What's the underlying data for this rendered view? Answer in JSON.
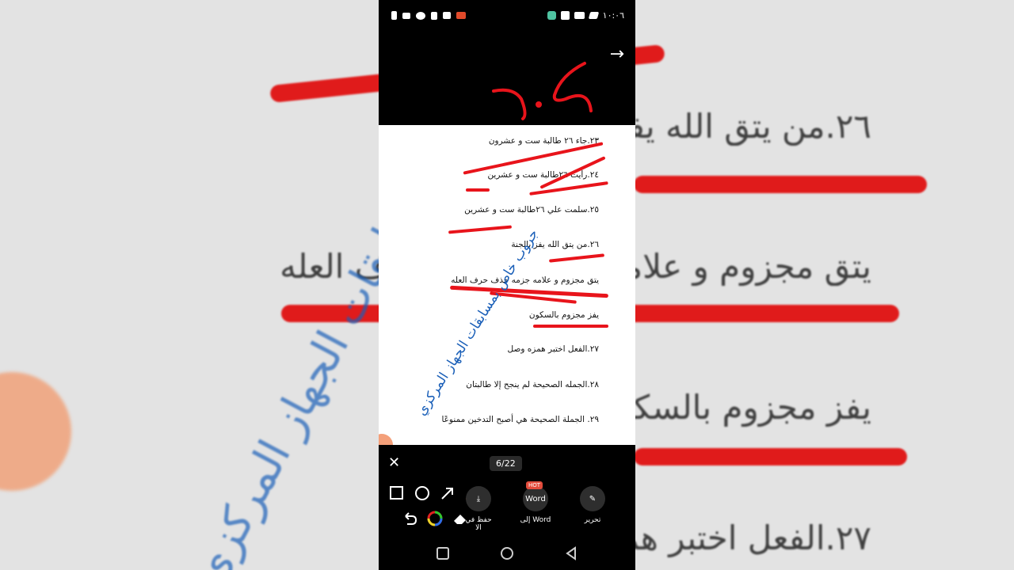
{
  "background": {
    "lines": [
      "٢٦.من يتق الله يفز",
      "يتق مجزوم و علامه جزمه حذف حرف العله",
      "يفز مجزوم بالسكون",
      "٢٧.الفعل اختبر همزه وصل"
    ],
    "watermark": "جروب خاص بمسابقات الجهاز المركزي"
  },
  "status_bar": {
    "time": "١٠:٠٦"
  },
  "document": {
    "lines": [
      "٢٣.جاء ٢٦ طالبة ست و عشرون",
      "٢٤.رأيت ٢٦طالبة ست و عشرين",
      "٢٥.سلمت علي ٢٦طالبة ست و عشرين",
      "٢٦.من يتق الله يفز بالجنة",
      "يتق مجزوم و علامه جزمه حذف حرف العله",
      "يفز مجزوم بالسكون",
      "٢٧.الفعل اختبر همزه وصل",
      "٢٨.الجمله الصحيحة لم ينجح إلا طالبتان",
      "٢٩. الجملة الصحيحة هي أصبح التدخين ممنوعًا"
    ],
    "handwritten_number": "٢٠٢",
    "watermark": "جروب خاص بمسابقات الجهاز المركزي"
  },
  "toolbar": {
    "page_indicator": "6/22",
    "actions": [
      {
        "label": "حفظ في الا",
        "icon": "download-icon"
      },
      {
        "label": "إلى Word",
        "icon": "word-icon",
        "badge": "HOT",
        "icon_text": "Word"
      },
      {
        "label": "تحرير",
        "icon": "edit-icon"
      }
    ]
  },
  "colors": {
    "annotation_red": "#e8141b",
    "watermark_blue": "#1a5fb8"
  }
}
